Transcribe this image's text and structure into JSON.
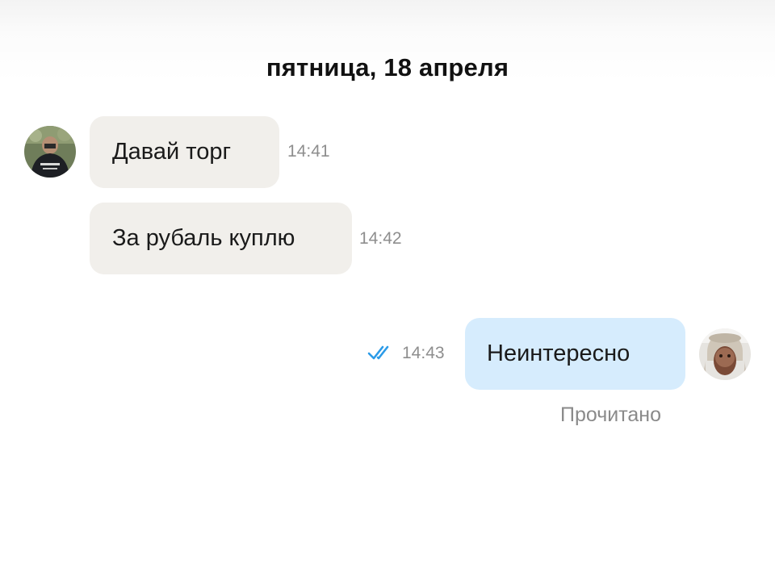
{
  "chat": {
    "date_header": "пятница, 18 апреля",
    "messages": [
      {
        "direction": "incoming",
        "text": "Давай торг",
        "time": "14:41"
      },
      {
        "direction": "incoming",
        "text": "За рубаль куплю",
        "time": "14:42"
      },
      {
        "direction": "outgoing",
        "text": "Неинтересно",
        "time": "14:43",
        "status": "Прочитано",
        "read_icon": "double-check-icon"
      }
    ]
  },
  "colors": {
    "incoming_bubble": "#f1efeb",
    "outgoing_bubble": "#d6ecfd",
    "check_mark": "#2b9be8",
    "timestamp": "#8e8e8e"
  }
}
